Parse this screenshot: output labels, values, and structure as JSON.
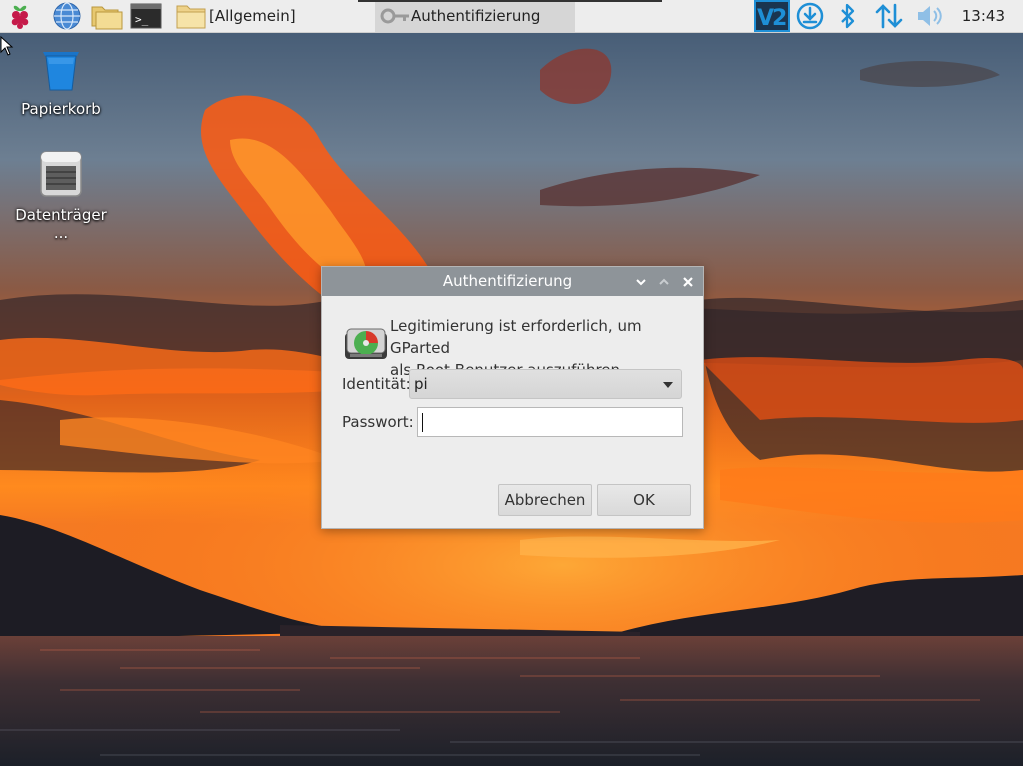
{
  "taskbar": {
    "launchers": [
      "raspberry-menu-icon",
      "web-browser-icon",
      "file-manager-icon",
      "terminal-icon"
    ],
    "windows": [
      {
        "label": "[Allgemein]",
        "icon": "folder-icon",
        "active": false
      },
      {
        "label": "Authentifizierung",
        "icon": "key-icon",
        "active": true
      }
    ],
    "tray": [
      "vnc-icon",
      "update-download-icon",
      "bluetooth-icon",
      "network-icon",
      "volume-icon"
    ],
    "clock": "13:43"
  },
  "desktop": {
    "icons": [
      {
        "label": "Papierkorb",
        "icon": "trash-icon"
      },
      {
        "label": "Datenträger ...",
        "icon": "drive-icon"
      }
    ]
  },
  "dialog": {
    "title": "Authentifizierung",
    "message_line1": "Legitimierung ist erforderlich, um GParted",
    "message_line2": "als Root-Benutzer auszuführen",
    "identity_label": "Identität:",
    "identity_value": "pi",
    "password_label": "Passwort:",
    "password_value": "",
    "cancel_label": "Abbrechen",
    "ok_label": "OK"
  },
  "colors": {
    "taskbar_bg": "#ededed",
    "titlebar_bg": "#8e9499",
    "tray_accent": "#1e8fd6"
  }
}
